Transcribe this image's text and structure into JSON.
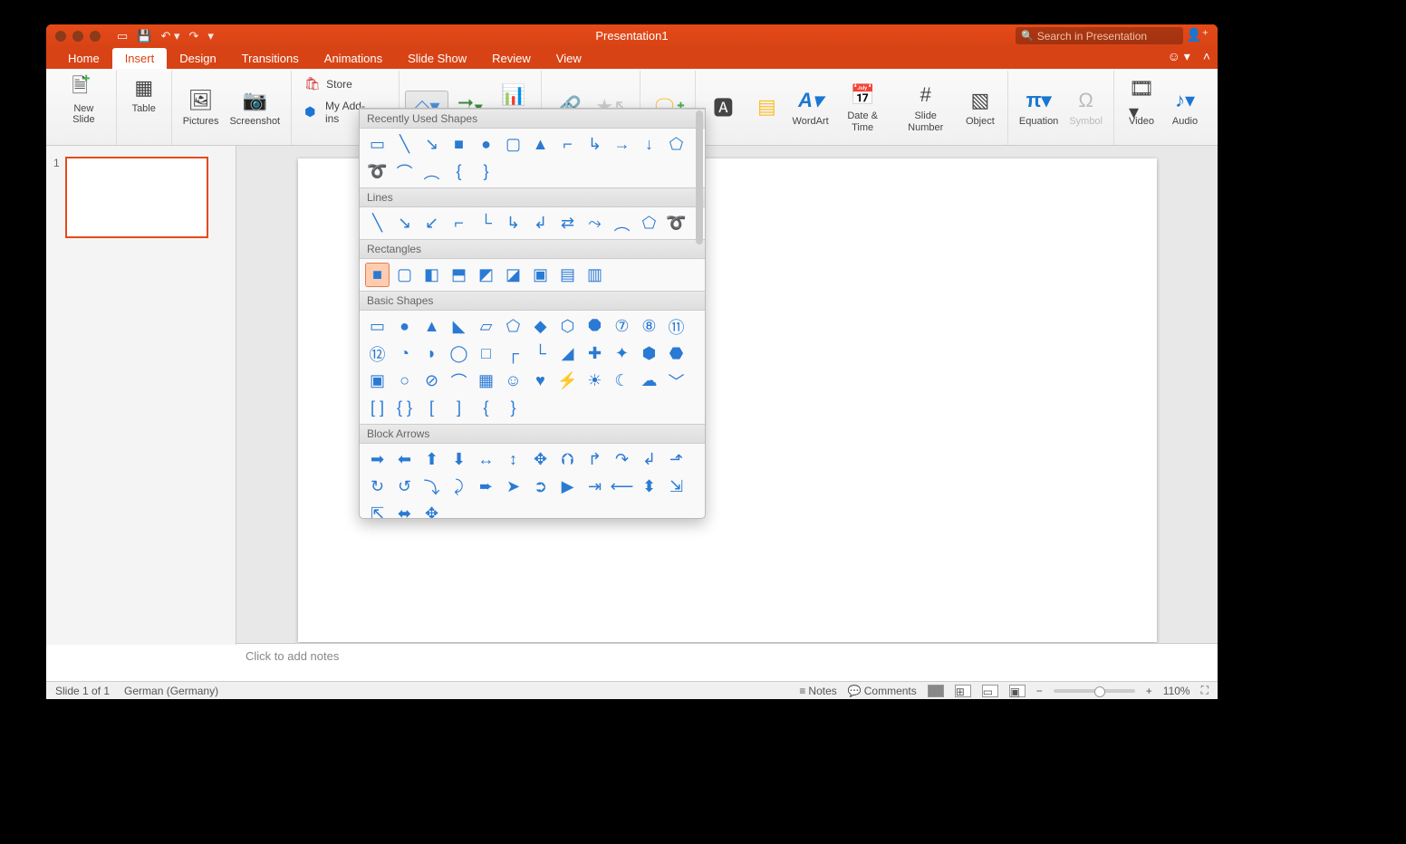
{
  "title": "Presentation1",
  "search_placeholder": "Search in Presentation",
  "tabs": [
    "Home",
    "Insert",
    "Design",
    "Transitions",
    "Animations",
    "Slide Show",
    "Review",
    "View"
  ],
  "active_tab": 1,
  "ribbon": {
    "new_slide": "New Slide",
    "table": "Table",
    "pictures": "Pictures",
    "screenshot": "Screenshot",
    "store": "Store",
    "my_addins": "My Add-ins",
    "wordart": "WordArt",
    "date_time": "Date & Time",
    "slide_number": "Slide Number",
    "object": "Object",
    "equation": "Equation",
    "symbol": "Symbol",
    "video": "Video",
    "audio": "Audio"
  },
  "shapes_dropdown": {
    "categories": [
      {
        "name": "Recently Used Shapes",
        "count": 17
      },
      {
        "name": "Lines",
        "count": 12
      },
      {
        "name": "Rectangles",
        "count": 9,
        "selected_index": 0
      },
      {
        "name": "Basic Shapes",
        "count": 42
      },
      {
        "name": "Block Arrows",
        "count": 27
      }
    ]
  },
  "thumbnail_number": "1",
  "notes_placeholder": "Click to add notes",
  "status": {
    "slide_info": "Slide 1 of 1",
    "language": "German (Germany)",
    "notes_btn": "Notes",
    "comments_btn": "Comments",
    "zoom": "110%"
  }
}
